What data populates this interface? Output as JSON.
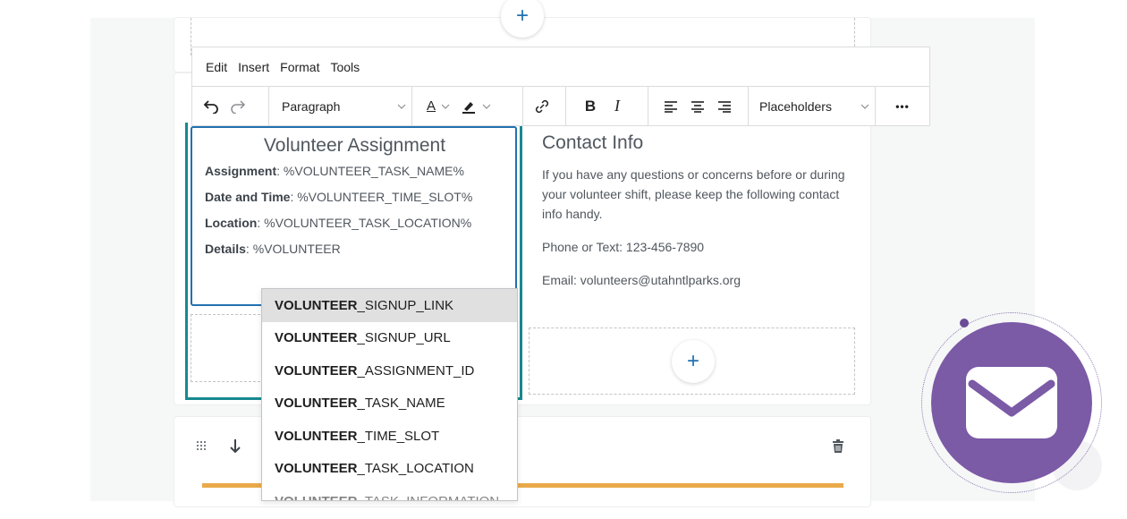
{
  "menubar": {
    "items": [
      "Edit",
      "Insert",
      "Format",
      "Tools"
    ]
  },
  "toolbar": {
    "block_format": "Paragraph",
    "text_color_letter": "A",
    "bold_letter": "B",
    "italic_letter": "I",
    "placeholders_label": "Placeholders",
    "more_label": "•••"
  },
  "assignment_block": {
    "title": "Volunteer Assignment",
    "rows": [
      {
        "label": "Assignment",
        "value": ": %VOLUNTEER_TASK_NAME%"
      },
      {
        "label": "Date and Time",
        "value": ": %VOLUNTEER_TIME_SLOT%"
      },
      {
        "label": "Location",
        "value": ": %VOLUNTEER_TASK_LOCATION%"
      },
      {
        "label": "Details",
        "value": ": %VOLUNTEER"
      }
    ]
  },
  "contact_block": {
    "title": "Contact Info",
    "intro": "If you have any questions or concerns before or during your volunteer shift, please keep the following contact info handy.",
    "phone": "Phone or Text: 123-456-7890",
    "email": "Email: volunteers@utahntlparks.org"
  },
  "autocomplete": {
    "match": "VOLUNTEER",
    "items": [
      {
        "prefix": "VOLUNTEER",
        "suffix": "_SIGNUP_LINK",
        "active": true
      },
      {
        "prefix": "VOLUNTEER",
        "suffix": "_SIGNUP_URL",
        "active": false
      },
      {
        "prefix": "VOLUNTEER",
        "suffix": "_ASSIGNMENT_ID",
        "active": false
      },
      {
        "prefix": "VOLUNTEER",
        "suffix": "_TASK_NAME",
        "active": false
      },
      {
        "prefix": "VOLUNTEER",
        "suffix": "_TIME_SLOT",
        "active": false
      },
      {
        "prefix": "VOLUNTEER",
        "suffix": "_TASK_LOCATION",
        "active": false
      },
      {
        "prefix": "VOLUNTEER",
        "suffix": "_TASK_INFORMATION",
        "active": false
      }
    ]
  },
  "add_block_symbol": "+",
  "colors": {
    "accent_teal": "#17898f",
    "selection_blue": "#2271b1",
    "orange_bar": "#e9a94a",
    "mail_purple": "#7b5aa6"
  },
  "icons": [
    "undo-icon",
    "redo-icon",
    "text-color-icon",
    "highlight-icon",
    "link-icon",
    "align-left-icon",
    "align-center-icon",
    "align-right-icon",
    "drag-handle-icon",
    "move-down-icon",
    "trash-icon",
    "mail-icon"
  ]
}
